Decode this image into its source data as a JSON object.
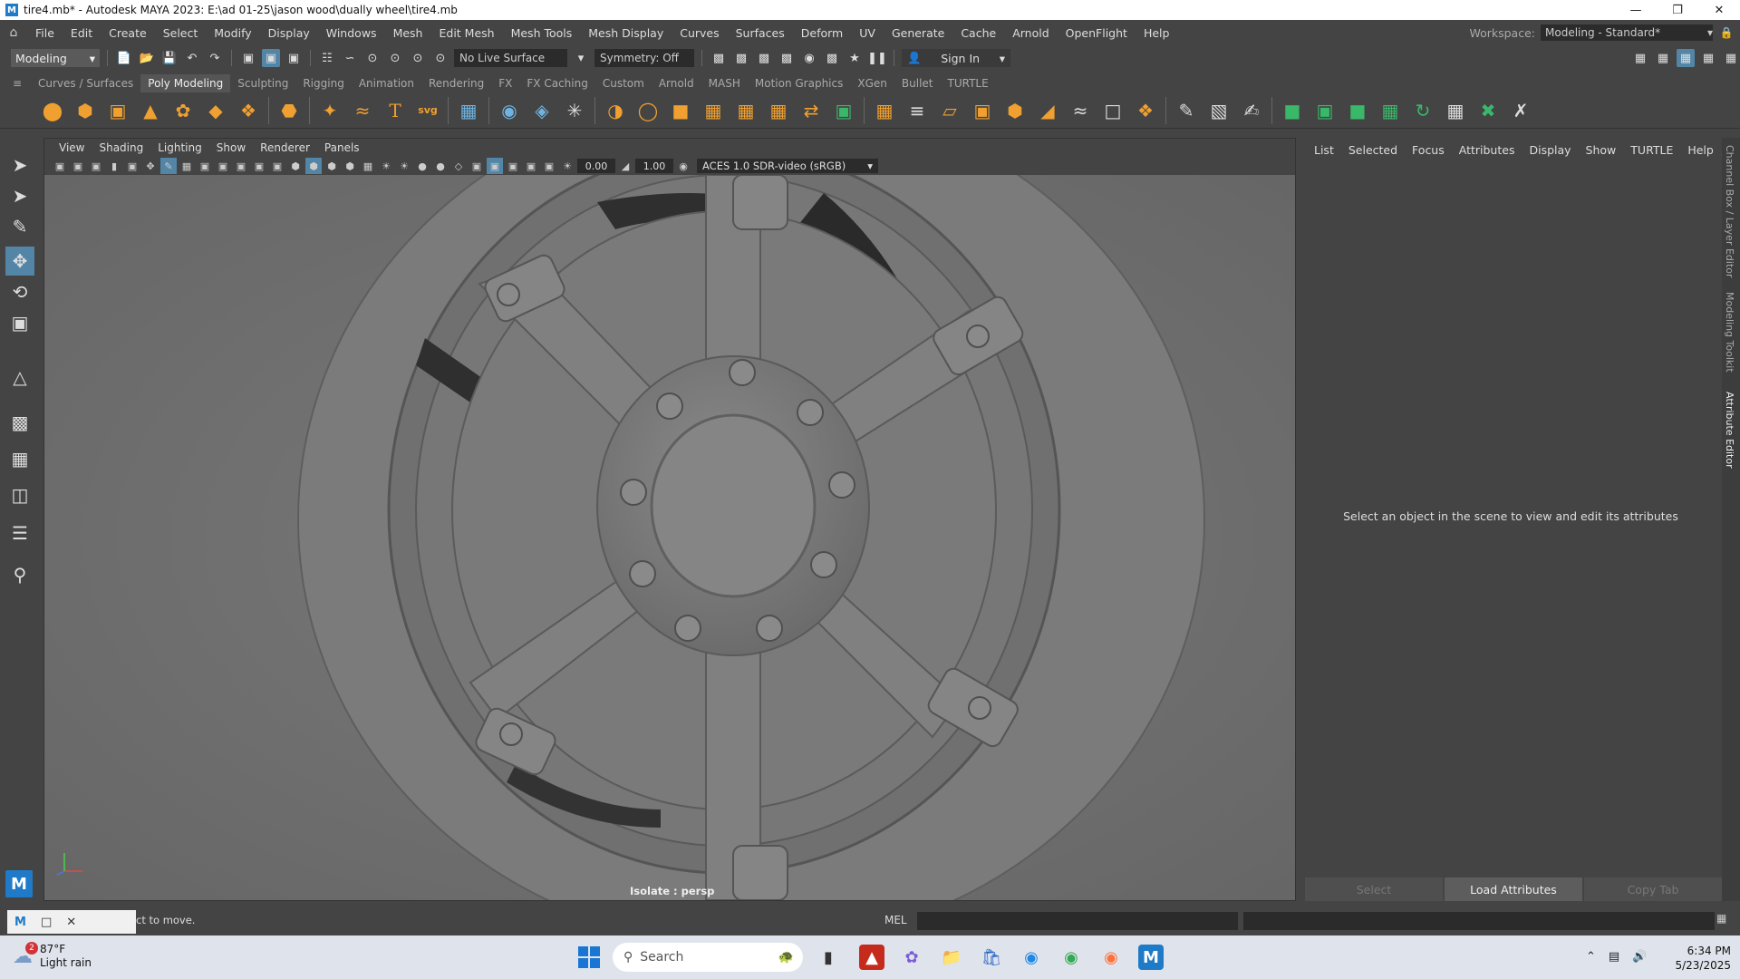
{
  "window": {
    "title": "tire4.mb* - Autodesk MAYA 2023: E:\\ad 01-25\\jason wood\\dually wheel\\tire4.mb",
    "logo": "M"
  },
  "menubar": {
    "items": [
      "File",
      "Edit",
      "Create",
      "Select",
      "Modify",
      "Display",
      "Windows",
      "Mesh",
      "Edit Mesh",
      "Mesh Tools",
      "Mesh Display",
      "Curves",
      "Surfaces",
      "Deform",
      "UV",
      "Generate",
      "Cache",
      "Arnold",
      "OpenFlight",
      "Help"
    ],
    "workspace_label": "Workspace:",
    "workspace_value": "Modeling - Standard*"
  },
  "statusline": {
    "mode": "Modeling",
    "live_surface": "No Live Surface",
    "symmetry": "Symmetry: Off",
    "sign_in": "Sign In"
  },
  "shelf": {
    "tabs": [
      "Curves / Surfaces",
      "Poly Modeling",
      "Sculpting",
      "Rigging",
      "Animation",
      "Rendering",
      "FX",
      "FX Caching",
      "Custom",
      "Arnold",
      "MASH",
      "Motion Graphics",
      "XGen",
      "Bullet",
      "TURTLE"
    ],
    "active_tab": "Poly Modeling",
    "svg_label": "svg",
    "text_label": "T"
  },
  "viewport": {
    "menu": [
      "View",
      "Shading",
      "Lighting",
      "Show",
      "Renderer",
      "Panels"
    ],
    "field_a": "0.00",
    "field_b": "1.00",
    "color_space": "ACES 1.0 SDR-video (sRGB)",
    "isolate_label": "Isolate : persp"
  },
  "attribute_editor": {
    "menu": [
      "List",
      "Selected",
      "Focus",
      "Attributes",
      "Display",
      "Show",
      "TURTLE",
      "Help"
    ],
    "hint": "Select an object in the scene to view and edit its attributes",
    "buttons": {
      "select": "Select",
      "load": "Load Attributes",
      "copy": "Copy Tab"
    }
  },
  "side_tabs": [
    "Channel Box / Layer Editor",
    "Modeling Toolkit",
    "Attribute Editor"
  ],
  "command_line": {
    "help_text": "ct to move.",
    "mel_label": "MEL"
  },
  "taskbar": {
    "weather_temp": "87°F",
    "weather_desc": "Light rain",
    "weather_badge": "2",
    "search_placeholder": "Search",
    "time": "6:34 PM",
    "date": "5/23/2025"
  },
  "colors": {
    "accent": "#5285a6",
    "maya_blue": "#1f7bc7",
    "shelf_orange": "#f0a030",
    "shelf_green": "#3ab86a"
  }
}
